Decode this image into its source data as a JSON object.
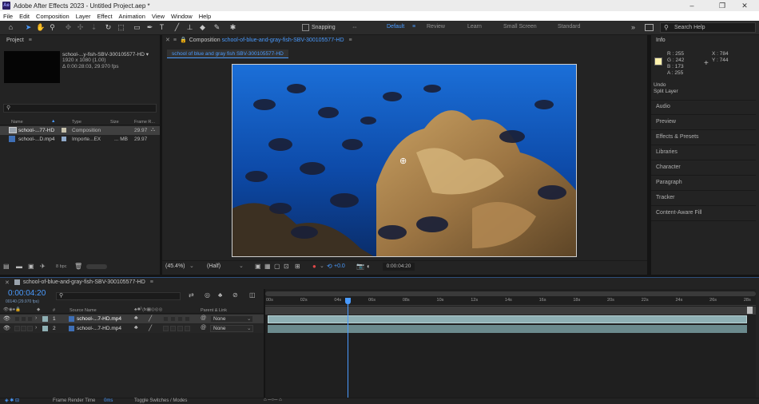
{
  "app": {
    "title": "Adobe After Effects 2023 - Untitled Project.aep *",
    "logo": "Ae",
    "window_controls": [
      "–",
      "❐",
      "✕"
    ]
  },
  "menu": [
    "File",
    "Edit",
    "Composition",
    "Layer",
    "Effect",
    "Animation",
    "View",
    "Window",
    "Help"
  ],
  "toolbar": {
    "snapping_label": "Snapping",
    "workspaces": [
      "Default",
      "Review",
      "Learn",
      "Small Screen",
      "Standard"
    ],
    "active_workspace": "Default",
    "search_placeholder": "Search Help"
  },
  "project": {
    "header": "Project",
    "thumb_name": "school-...y-fish-SBV-300105577-HD ▾",
    "thumb_res": "1920 x 1080 (1.00)",
    "thumb_dur": "Δ 0:00:28:03, 29.970 fps",
    "search_placeholder": "",
    "columns": [
      "Name",
      "Type",
      "Size",
      "Frame R..."
    ],
    "items": [
      {
        "name": "school-...77-HD",
        "type": "Composition",
        "size": "",
        "fps": "29.97",
        "icon": "composition-icon",
        "selected": true
      },
      {
        "name": "school-...D.mp4",
        "type": "Importe...EX",
        "size": "... MB",
        "fps": "29.97",
        "icon": "footage-icon",
        "selected": false
      }
    ],
    "bpc": "8 bpc"
  },
  "composition": {
    "header_prefix": "Composition",
    "header_name": "school-of-blue-and-gray-fish-SBV-300105577-HD",
    "tab_label": "school of blue and gray fish SBV-300105577-HD",
    "zoom": "(45.4%)",
    "resolution": "(Half)",
    "exposure": "+0.0",
    "timecode": "0:00:04:20"
  },
  "info": {
    "header": "Info",
    "r": "R : 255",
    "g": "G : 242",
    "b": "B : 173",
    "a": "A : 255",
    "x": "X : 784",
    "y": "Y : 744",
    "undo": "Undo",
    "undo_action": "Split Layer",
    "swatch_color": "#fff2ad",
    "panels": [
      "Audio",
      "Preview",
      "Effects & Presets",
      "Libraries",
      "Character",
      "Paragraph",
      "Tracker",
      "Content-Aware Fill"
    ]
  },
  "timeline": {
    "tab_name": "school-of-blue-and-gray-fish-SBV-300105577-HD",
    "timecode": "0:00:04:20",
    "frame_info": "00140 (29.970 fps)",
    "col_source": "Source Name",
    "col_hash": "#",
    "col_parent": "Parent & Link",
    "ruler": [
      "00s",
      "02s",
      "04s",
      "06s",
      "08s",
      "10s",
      "12s",
      "14s",
      "16s",
      "18s",
      "20s",
      "22s",
      "24s",
      "26s",
      "28s"
    ],
    "layers": [
      {
        "index": "1",
        "name": "school-...7-HD.mp4",
        "parent": "None",
        "selected": true
      },
      {
        "index": "2",
        "name": "school-...7-HD.mp4",
        "parent": "None",
        "selected": false
      }
    ],
    "playhead_seconds": 4.67,
    "duration_seconds": 28.1
  },
  "status": {
    "render_label": "Frame Render Time",
    "render_value": "0ms",
    "toggle_label": "Toggle Switches / Modes"
  }
}
